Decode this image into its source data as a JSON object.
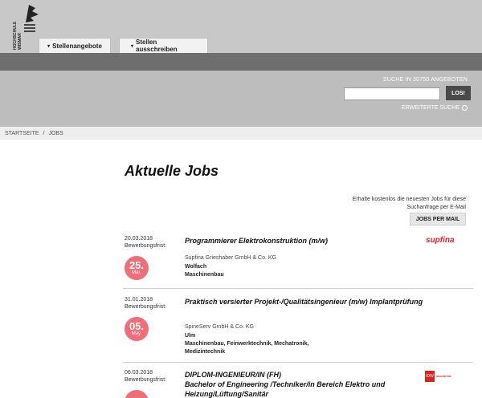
{
  "header": {
    "logo_alt": "HOCHSCHULE WISMAR",
    "tabs": [
      {
        "label": "Stellenangebote"
      },
      {
        "label": "Stellen ausschreiben"
      }
    ]
  },
  "search": {
    "count_label": "SUCHE IN 30750 ANGEBOTEN",
    "input_value": "",
    "button_label": "LOS!",
    "advanced_label": "ERWEITERTE SUCHE"
  },
  "breadcrumb": {
    "home": "STARTSEITE",
    "separator": "/",
    "current": "JOBS"
  },
  "main": {
    "title": "Aktuelle Jobs",
    "alert_text_line1": "Erhalte kostenlos die neuesten Jobs für diese",
    "alert_text_line2": "Suchanfrage per E-Mail",
    "alert_button": "JOBS PER MAIL"
  },
  "jobs": [
    {
      "date": "20.03.2018",
      "deadline_label": "Bewerbungsfrist:",
      "day": "25.",
      "month": "Mar.",
      "title": "Programmierer Elektrokonstruktion (m/w)",
      "company": "Supfina Grieshaber GmbH & Co. KG",
      "location": "Wolfach",
      "fields": "Maschinenbau",
      "logo_text": "supfina"
    },
    {
      "date": "31.01.2018",
      "deadline_label": "Bewerbungsfrist:",
      "day": "05.",
      "month": "May.",
      "title": "Praktisch versierter Projekt-/Qualitätsingenieur (m/w) Implantprüfung",
      "company": "SpineServ GmbH & Co. KG",
      "location": "Ulm",
      "fields": "Maschinenbau, Feinwerktechnik, Mechatronik,",
      "fields2": "Medizintechnik"
    },
    {
      "date": "06.03.2018",
      "deadline_label": "Bewerbungsfrist:",
      "title_line1": "DIPLOM-INGENIEUR/IN (FH)",
      "title_line2": "Bachelor of Engineering /Techniker/in Bereich Elektro und",
      "title_line3": "Heizung/Lüftung/Sanitär",
      "logo_text": "IDW",
      "logo_sub": "INGENIEURE"
    }
  ],
  "colors": {
    "accent_pink": "#f06d7a",
    "dark_bar": "#6e6e6e",
    "supfina_red": "#e0222b"
  }
}
